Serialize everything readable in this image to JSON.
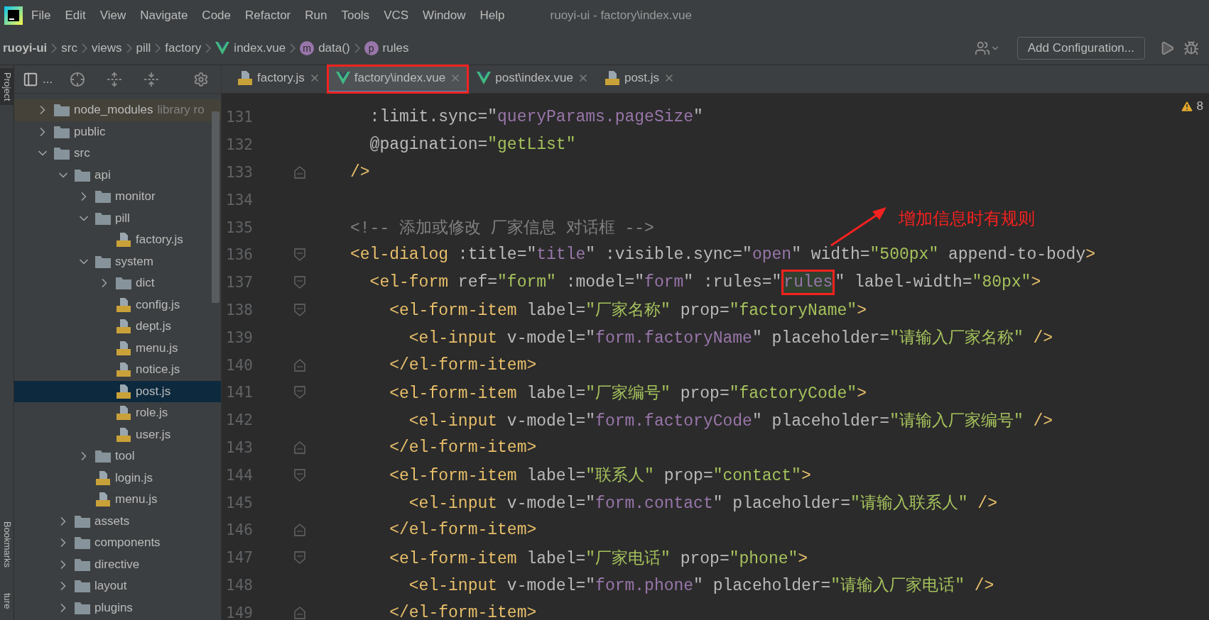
{
  "menu_bar": {
    "items": [
      "File",
      "Edit",
      "View",
      "Navigate",
      "Code",
      "Refactor",
      "Run",
      "Tools",
      "VCS",
      "Window",
      "Help"
    ],
    "title": "ruoyi-ui - factory\\index.vue"
  },
  "breadcrumb": [
    {
      "label": "ruoyi-ui",
      "kind": "project"
    },
    {
      "label": "src",
      "kind": "folder"
    },
    {
      "label": "views",
      "kind": "folder"
    },
    {
      "label": "pill",
      "kind": "folder"
    },
    {
      "label": "factory",
      "kind": "folder"
    },
    {
      "label": "index.vue",
      "kind": "vue"
    },
    {
      "label": "data()",
      "kind": "method",
      "badge": "m"
    },
    {
      "label": "rules",
      "kind": "property",
      "badge": "p"
    }
  ],
  "run_toolbar": {
    "config_button": "Add Configuration..."
  },
  "side_strip": [
    {
      "label": "Project",
      "selected": true
    },
    {
      "label": "Bookmarks",
      "selected": false
    },
    {
      "label": "ture",
      "selected": false
    }
  ],
  "project_panel": {
    "title": "...",
    "tree": [
      {
        "label": "node_modules",
        "kind": "library",
        "note": "library ro",
        "expanded": false,
        "selected": false
      },
      {
        "label": "public",
        "kind": "folder",
        "expanded": false,
        "selected": false
      },
      {
        "label": "src",
        "kind": "folder",
        "expanded": true,
        "selected": false,
        "children": [
          {
            "label": "api",
            "kind": "folder",
            "expanded": true,
            "selected": false,
            "children": [
              {
                "label": "monitor",
                "kind": "folder",
                "expanded": false,
                "selected": false
              },
              {
                "label": "pill",
                "kind": "folder",
                "expanded": true,
                "selected": false,
                "children": [
                  {
                    "label": "factory.js",
                    "kind": "js",
                    "selected": false
                  }
                ]
              },
              {
                "label": "system",
                "kind": "folder",
                "expanded": true,
                "selected": false,
                "children": [
                  {
                    "label": "dict",
                    "kind": "folder",
                    "expanded": false,
                    "selected": false
                  },
                  {
                    "label": "config.js",
                    "kind": "js",
                    "selected": false
                  },
                  {
                    "label": "dept.js",
                    "kind": "js",
                    "selected": false
                  },
                  {
                    "label": "menu.js",
                    "kind": "js",
                    "selected": false
                  },
                  {
                    "label": "notice.js",
                    "kind": "js",
                    "selected": false
                  },
                  {
                    "label": "post.js",
                    "kind": "js",
                    "selected": true
                  },
                  {
                    "label": "role.js",
                    "kind": "js",
                    "selected": false
                  },
                  {
                    "label": "user.js",
                    "kind": "js",
                    "selected": false
                  }
                ]
              },
              {
                "label": "tool",
                "kind": "folder",
                "expanded": false,
                "selected": false
              },
              {
                "label": "login.js",
                "kind": "js",
                "selected": false
              },
              {
                "label": "menu.js",
                "kind": "js",
                "selected": false
              }
            ]
          },
          {
            "label": "assets",
            "kind": "folder",
            "expanded": false,
            "selected": false
          },
          {
            "label": "components",
            "kind": "folder",
            "expanded": false,
            "selected": false
          },
          {
            "label": "directive",
            "kind": "folder",
            "expanded": false,
            "selected": false
          },
          {
            "label": "layout",
            "kind": "folder",
            "expanded": false,
            "selected": false
          },
          {
            "label": "plugins",
            "kind": "folder",
            "expanded": false,
            "selected": false
          }
        ]
      }
    ]
  },
  "tabs": [
    {
      "label": "factory.js",
      "kind": "js",
      "selected": false,
      "marked": false
    },
    {
      "label": "factory\\index.vue",
      "kind": "vue",
      "selected": true,
      "marked": true
    },
    {
      "label": "post\\index.vue",
      "kind": "vue",
      "selected": false,
      "marked": false
    },
    {
      "label": "post.js",
      "kind": "js",
      "selected": false,
      "marked": false
    }
  ],
  "editor": {
    "warnings": "8",
    "lines": [
      {
        "number": "131",
        "kind": "plain",
        "tokens": [
          {
            "text": "  :limit.sync=\"",
            "kind": "attr"
          },
          {
            "text": "queryParams.pageSize",
            "kind": "ref"
          },
          {
            "text": "\"",
            "kind": "attr"
          }
        ]
      },
      {
        "number": "132",
        "kind": "plain",
        "tokens": [
          {
            "text": "  @pagination=",
            "kind": "attr"
          },
          {
            "text": "\"getList\"",
            "kind": "value"
          }
        ]
      },
      {
        "number": "133",
        "kind": "fold_end",
        "tokens": [
          {
            "text": "/>",
            "kind": "tag"
          }
        ]
      },
      {
        "number": "134",
        "kind": "plain"
      },
      {
        "number": "135",
        "kind": "plain",
        "tokens": [
          {
            "text": "<!-- 添加或修改 厂家信息 对话框 -->",
            "kind": "comment"
          }
        ]
      },
      {
        "number": "136",
        "kind": "fold_start",
        "tokens": [
          {
            "text": "<el-dialog",
            "kind": "tag"
          },
          {
            "text": " :title=\"",
            "kind": "attr"
          },
          {
            "text": "title",
            "kind": "ref"
          },
          {
            "text": "\" :visible.sync=\"",
            "kind": "attr"
          },
          {
            "text": "open",
            "kind": "ref"
          },
          {
            "text": "\" width=",
            "kind": "attr"
          },
          {
            "text": "\"500px\"",
            "kind": "value"
          },
          {
            "text": " append-to-body",
            "kind": "attr"
          },
          {
            "text": ">",
            "kind": "tag"
          }
        ]
      },
      {
        "number": "137",
        "kind": "fold_start",
        "tokens": [
          {
            "text": "  <el-form",
            "kind": "tag"
          },
          {
            "text": " ref=",
            "kind": "attr"
          },
          {
            "text": "\"form\"",
            "kind": "value"
          },
          {
            "text": " :model=\"",
            "kind": "attr"
          },
          {
            "text": "form",
            "kind": "ref"
          },
          {
            "text": "\" :rules=\"",
            "kind": "attr"
          },
          {
            "text": "rules",
            "kind": "match",
            "marked": true
          },
          {
            "text": "\" label-width=",
            "kind": "attr"
          },
          {
            "text": "\"80px\"",
            "kind": "value"
          },
          {
            "text": ">",
            "kind": "tag"
          }
        ]
      },
      {
        "number": "138",
        "kind": "fold_start",
        "tokens": [
          {
            "text": "    <el-form-item",
            "kind": "tag"
          },
          {
            "text": " label=",
            "kind": "attr"
          },
          {
            "text": "\"厂家名称\"",
            "kind": "value"
          },
          {
            "text": " prop=",
            "kind": "attr"
          },
          {
            "text": "\"factoryName\"",
            "kind": "value"
          },
          {
            "text": ">",
            "kind": "tag"
          }
        ]
      },
      {
        "number": "139",
        "kind": "plain",
        "tokens": [
          {
            "text": "      <el-input",
            "kind": "tag"
          },
          {
            "text": " v-model=\"",
            "kind": "attr"
          },
          {
            "text": "form.factoryName",
            "kind": "ref"
          },
          {
            "text": "\" placeholder=",
            "kind": "attr"
          },
          {
            "text": "\"请输入厂家名称\"",
            "kind": "value"
          },
          {
            "text": " />",
            "kind": "tag"
          }
        ]
      },
      {
        "number": "140",
        "kind": "fold_end",
        "tokens": [
          {
            "text": "    </el-form-item>",
            "kind": "tag"
          }
        ]
      },
      {
        "number": "141",
        "kind": "fold_start",
        "tokens": [
          {
            "text": "    <el-form-item",
            "kind": "tag"
          },
          {
            "text": " label=",
            "kind": "attr"
          },
          {
            "text": "\"厂家编号\"",
            "kind": "value"
          },
          {
            "text": " prop=",
            "kind": "attr"
          },
          {
            "text": "\"factoryCode\"",
            "kind": "value"
          },
          {
            "text": ">",
            "kind": "tag"
          }
        ]
      },
      {
        "number": "142",
        "kind": "plain",
        "tokens": [
          {
            "text": "      <el-input",
            "kind": "tag"
          },
          {
            "text": " v-model=\"",
            "kind": "attr"
          },
          {
            "text": "form.factoryCode",
            "kind": "ref"
          },
          {
            "text": "\" placeholder=",
            "kind": "attr"
          },
          {
            "text": "\"请输入厂家编号\"",
            "kind": "value"
          },
          {
            "text": " />",
            "kind": "tag"
          }
        ]
      },
      {
        "number": "143",
        "kind": "fold_end",
        "tokens": [
          {
            "text": "    </el-form-item>",
            "kind": "tag"
          }
        ]
      },
      {
        "number": "144",
        "kind": "fold_start",
        "tokens": [
          {
            "text": "    <el-form-item",
            "kind": "tag"
          },
          {
            "text": " label=",
            "kind": "attr"
          },
          {
            "text": "\"联系人\"",
            "kind": "value"
          },
          {
            "text": " prop=",
            "kind": "attr"
          },
          {
            "text": "\"contact\"",
            "kind": "value"
          },
          {
            "text": ">",
            "kind": "tag"
          }
        ]
      },
      {
        "number": "145",
        "kind": "plain",
        "tokens": [
          {
            "text": "      <el-input",
            "kind": "tag"
          },
          {
            "text": " v-model=\"",
            "kind": "attr"
          },
          {
            "text": "form.contact",
            "kind": "ref"
          },
          {
            "text": "\" placeholder=",
            "kind": "attr"
          },
          {
            "text": "\"请输入联系人\"",
            "kind": "value"
          },
          {
            "text": " />",
            "kind": "tag"
          }
        ]
      },
      {
        "number": "146",
        "kind": "fold_end",
        "tokens": [
          {
            "text": "    </el-form-item>",
            "kind": "tag"
          }
        ]
      },
      {
        "number": "147",
        "kind": "fold_start",
        "tokens": [
          {
            "text": "    <el-form-item",
            "kind": "tag"
          },
          {
            "text": " label=",
            "kind": "attr"
          },
          {
            "text": "\"厂家电话\"",
            "kind": "value"
          },
          {
            "text": " prop=",
            "kind": "attr"
          },
          {
            "text": "\"phone\"",
            "kind": "value"
          },
          {
            "text": ">",
            "kind": "tag"
          }
        ]
      },
      {
        "number": "148",
        "kind": "plain",
        "tokens": [
          {
            "text": "      <el-input",
            "kind": "tag"
          },
          {
            "text": " v-model=\"",
            "kind": "attr"
          },
          {
            "text": "form.phone",
            "kind": "ref"
          },
          {
            "text": "\" placeholder=",
            "kind": "attr"
          },
          {
            "text": "\"请输入厂家电话\"",
            "kind": "value"
          },
          {
            "text": " />",
            "kind": "tag"
          }
        ]
      },
      {
        "number": "149",
        "kind": "fold_end",
        "tokens": [
          {
            "text": "    </el-form-item>",
            "kind": "tag"
          }
        ]
      }
    ]
  },
  "annotation": {
    "text": "增加信息时有规则"
  }
}
